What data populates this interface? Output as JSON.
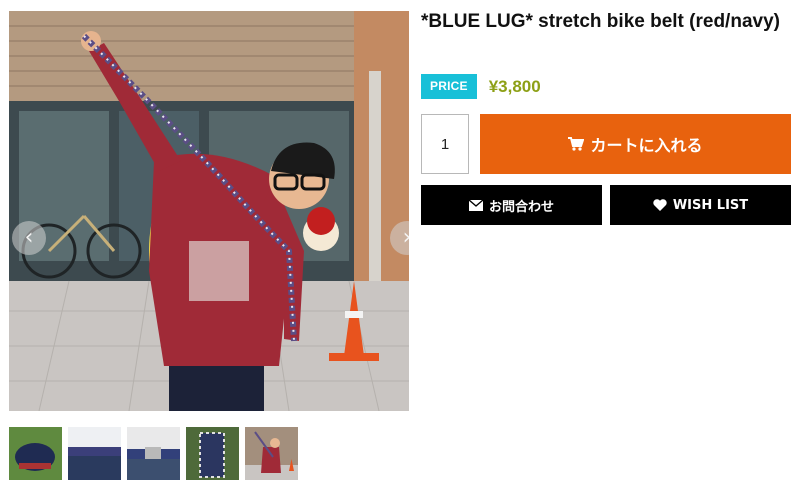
{
  "product": {
    "title": "*BLUE LUG* stretch bike belt (red/navy)",
    "price_badge": "PRICE",
    "price": "¥3,800",
    "quantity": "1"
  },
  "gallery": {
    "main_image_alt": "Man in red jersey stretching a red/navy bike belt overhead in front of a shop",
    "prev_symbol": "‹",
    "next_symbol": "›",
    "thumbnail_count": 5
  },
  "actions": {
    "cart_label": "カートに入れる",
    "inquiry_label": "お問合わせ",
    "wish_label": "WISH LIST"
  },
  "icons": {
    "cart": "cart-icon",
    "inquiry": "envelope-icon",
    "wish": "heart-icon",
    "prev": "chevron-left-icon",
    "next": "chevron-right-icon"
  },
  "colors": {
    "price_badge": "#18c0d8",
    "price_text": "#8da016",
    "cart_button": "#e8620e",
    "secondary_buttons": "#000000"
  }
}
